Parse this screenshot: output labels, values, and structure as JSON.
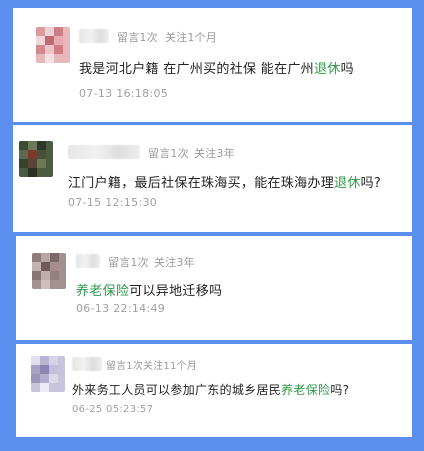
{
  "posts": [
    {
      "meta_count": "留言1次",
      "meta_follow": "关注1个月",
      "q_pre": "我是河北户籍 在广州买的社保 能在广州",
      "q_kw": "退休",
      "q_post": "吗",
      "time": "07-13 16:18:05"
    },
    {
      "meta_count": "留言1次",
      "meta_follow": "关注3年",
      "q_pre": "江门户籍，最后社保在珠海买，能在珠海办理",
      "q_kw": "退休",
      "q_post": "吗?",
      "time": "07-15 12:15:30"
    },
    {
      "meta_count": "留言1次",
      "meta_follow": "关注3年",
      "q_pre": "",
      "q_kw": "养老保险",
      "q_post": "可以异地迁移吗",
      "time": "06-13 22:14:49"
    },
    {
      "meta_count": "留言1次",
      "meta_follow": "关注11个月",
      "q_pre": "外来务工人员可以参加广东的城乡居民",
      "q_kw": "养老保险",
      "q_post": "吗?",
      "time": "06-25 05:23:57"
    }
  ],
  "colors": {
    "background": "#5b8fef",
    "keyword": "#2e9a4a"
  }
}
